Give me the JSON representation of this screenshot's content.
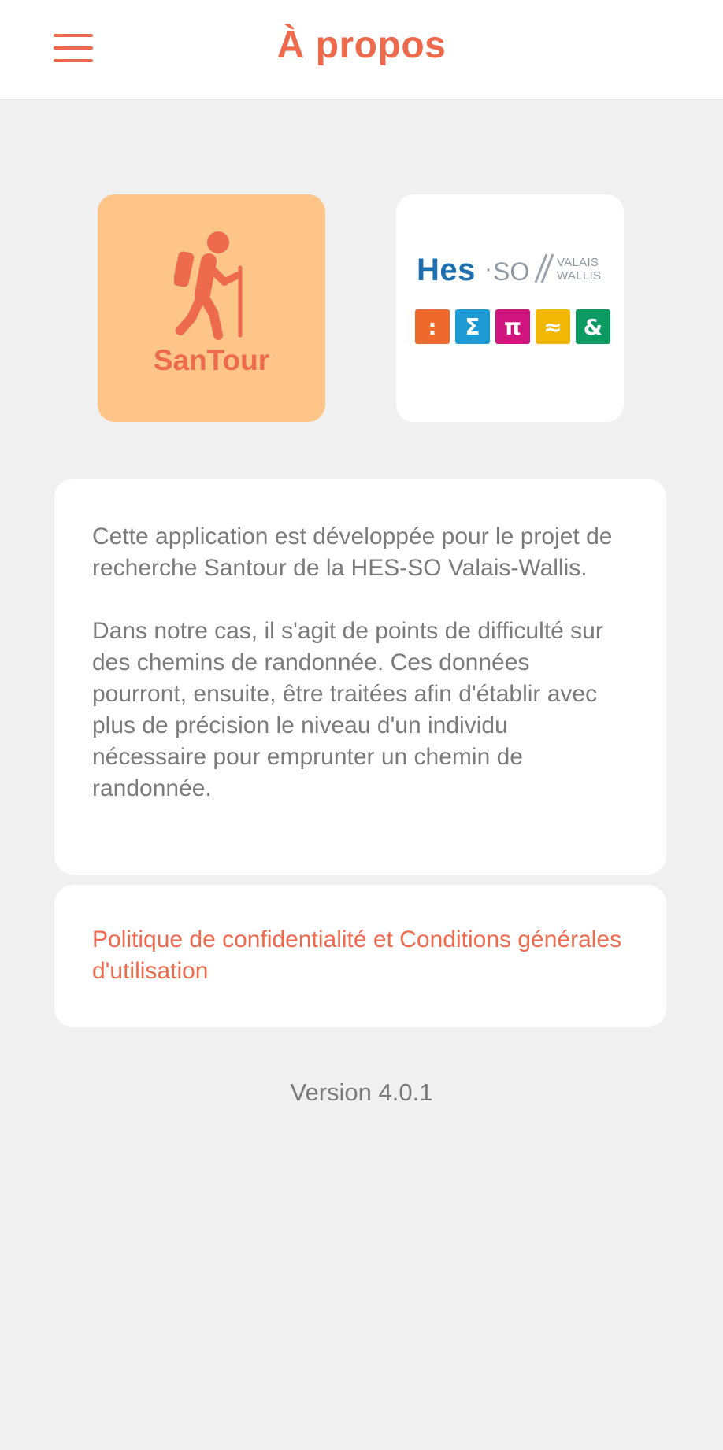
{
  "header": {
    "title": "À propos",
    "menu_icon": "hamburger-menu-icon",
    "accent_color": "#ee6a4d"
  },
  "logos": {
    "santour": {
      "label": "SanTour",
      "icon": "hiker-icon",
      "background": "#fdc688"
    },
    "hes": {
      "wordmark_main": "Hes",
      "wordmark_dot": "·",
      "wordmark_so": "SO",
      "wordmark_line1": "VALAIS",
      "wordmark_line2": "WALLIS",
      "squares": [
        {
          "symbol": ":",
          "color": "#ee6a2c"
        },
        {
          "symbol": "Σ",
          "color": "#1e9ad6"
        },
        {
          "symbol": "π",
          "color": "#d1157e"
        },
        {
          "symbol": "≈",
          "color": "#f2b705"
        },
        {
          "symbol": "&",
          "color": "#0c9a63"
        }
      ]
    }
  },
  "about": {
    "paragraph1": "Cette application est développée pour le projet de recherche Santour de la HES-SO Valais-Wallis.",
    "paragraph2": "Dans notre cas, il s'agit de points de difficulté sur des chemins de randonnée. Ces données pourront, ensuite, être traitées afin d'établir avec plus de précision le niveau d'un individu nécessaire pour emprunter un chemin de randonnée."
  },
  "policy": {
    "link_label": "Politique de confidentialité et Conditions générales d'utilisation"
  },
  "footer": {
    "version": "Version 4.0.1"
  }
}
